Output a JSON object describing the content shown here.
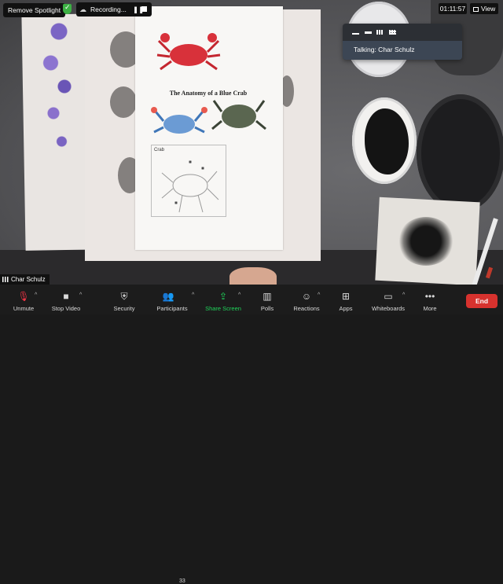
{
  "top": {
    "spotlight_label": "Remove Spotlight",
    "recording_label": "Recording...",
    "pause_glyph": "❚❚",
    "timer": "01:11:57",
    "view_label": "View"
  },
  "view_panel": {
    "talking": "Talking: Char Schulz"
  },
  "participant": {
    "name": "Char Schulz"
  },
  "sheet": {
    "title": "The Anatomy of a Blue Crab",
    "diagram_label": "Crab"
  },
  "toolbar": {
    "unmute": "Unmute",
    "stop_video": "Stop Video",
    "security": "Security",
    "participants": "Participants",
    "participant_count": "33",
    "share_screen": "Share Screen",
    "polls": "Polls",
    "reactions": "Reactions",
    "apps": "Apps",
    "whiteboards": "Whiteboards",
    "more": "More",
    "end": "End"
  },
  "colors": {
    "share_green": "#1fd45a",
    "end_red": "#d7322e",
    "toolbar_bg": "#1c1c1c",
    "shield_green": "#3cb043"
  }
}
